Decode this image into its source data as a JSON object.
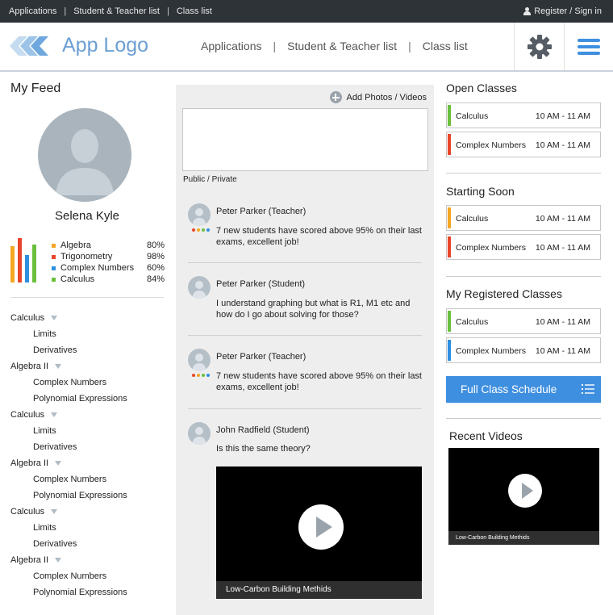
{
  "topbar": {
    "links": [
      "Applications",
      "Student & Teacher list",
      "Class list"
    ],
    "register_label": "Register / Sign in"
  },
  "header": {
    "logo_text": "App Logo",
    "nav": [
      "Applications",
      "Student & Teacher list",
      "Class list"
    ],
    "accent": "#6b9fd4"
  },
  "feed": {
    "title": "My Feed",
    "user_name": "Selena Kyle",
    "grades": [
      {
        "subject": "Algebra",
        "value": "80%",
        "pct": 80,
        "color": "#f5a623"
      },
      {
        "subject": "Trigonometry",
        "value": "98%",
        "pct": 98,
        "color": "#e8462a"
      },
      {
        "subject": "Complex Numbers",
        "value": "60%",
        "pct": 60,
        "color": "#2d8fe0"
      },
      {
        "subject": "Calculus",
        "value": "84%",
        "pct": 84,
        "color": "#6abf3c"
      }
    ],
    "tree": [
      {
        "label": "Calculus",
        "children": [
          "Limits",
          "Derivatives"
        ]
      },
      {
        "label": "Algebra II",
        "children": [
          "Complex Numbers",
          "Polynomial Expressions"
        ]
      },
      {
        "label": "Calculus",
        "children": [
          "Limits",
          "Derivatives"
        ]
      },
      {
        "label": "Algebra II",
        "children": [
          "Complex Numbers",
          "Polynomial Expressions"
        ]
      },
      {
        "label": "Calculus",
        "children": [
          "Limits",
          "Derivatives"
        ]
      },
      {
        "label": "Algebra II",
        "children": [
          "Complex Numbers",
          "Polynomial Expressions"
        ]
      }
    ]
  },
  "composer": {
    "add_label": "Add Photos / Videos",
    "visibility_label": "Public / Private"
  },
  "posts": [
    {
      "author": "Peter Parker (Teacher)",
      "text": "7 new students have scored above 95% on their last exams, excellent job!"
    },
    {
      "author": "Peter Parker (Student)",
      "text": "I understand graphing but what is R1, M1 etc and how do I go about solving for those?"
    },
    {
      "author": "Peter Parker (Teacher)",
      "text": "7 new students have scored above 95% on their last exams, excellent job!"
    },
    {
      "author": "John Radfield (Student)",
      "text": "Is this the same theory?"
    }
  ],
  "post_video": {
    "caption": "Low-Carbon Building Methids"
  },
  "open_classes": {
    "title": "Open Classes",
    "items": [
      {
        "name": "Calculus",
        "time": "10 AM - 11 AM",
        "color": "#6abf3c"
      },
      {
        "name": "Complex Numbers",
        "time": "10 AM - 11 AM",
        "color": "#e8462a"
      }
    ]
  },
  "starting_soon": {
    "title": "Starting Soon",
    "items": [
      {
        "name": "Calculus",
        "time": "10 AM - 11 AM",
        "color": "#f5a623"
      },
      {
        "name": "Complex Numbers",
        "time": "10 AM - 11 AM",
        "color": "#e8462a"
      }
    ]
  },
  "registered_classes": {
    "title": "My Registered Classes",
    "items": [
      {
        "name": "Calculus",
        "time": "10 AM - 11 AM",
        "color": "#6abf3c"
      },
      {
        "name": "Complex Numbers",
        "time": "10 AM - 11 AM",
        "color": "#2d8fe0"
      }
    ]
  },
  "schedule_button": {
    "label": "Full Class Schedule",
    "color": "#3f8fe0"
  },
  "recent_videos": {
    "title": "Recent Videos",
    "caption": "Low-Carbon Building Methids"
  }
}
